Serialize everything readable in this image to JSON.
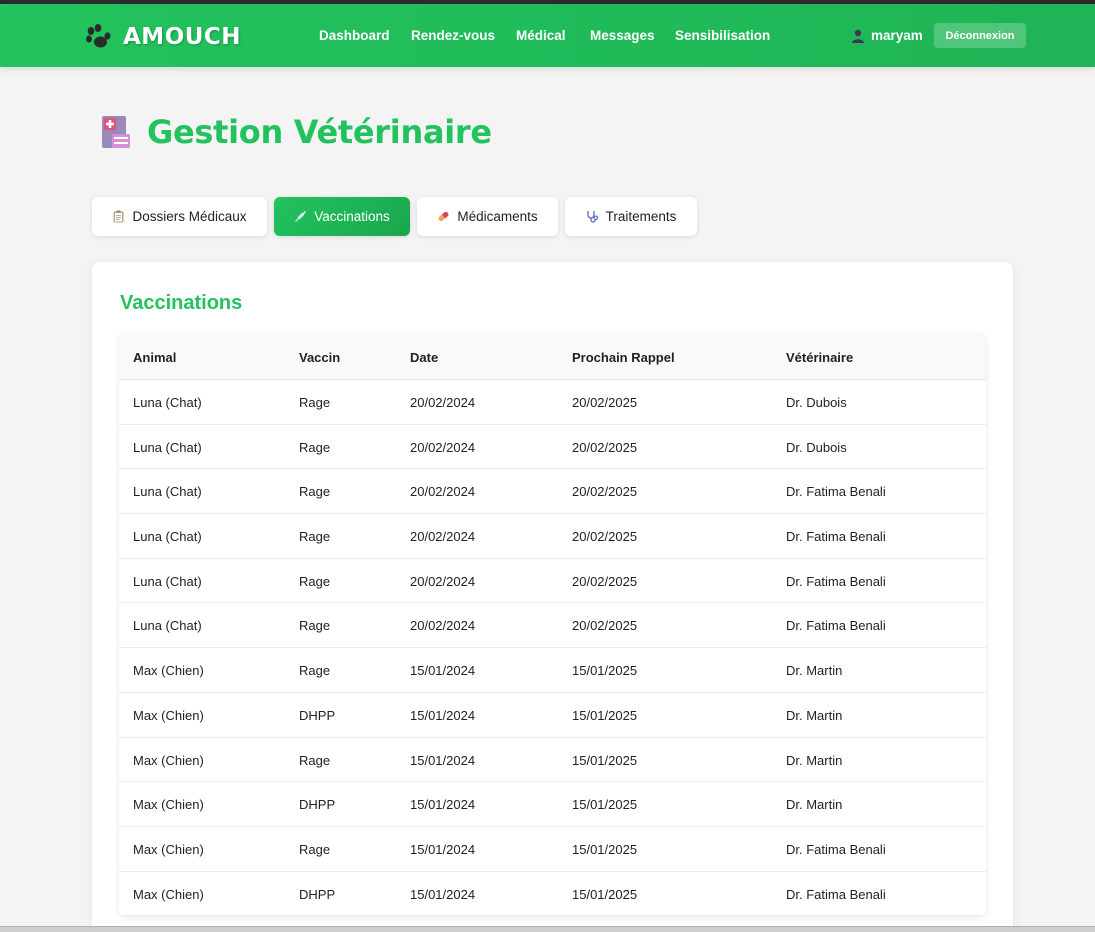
{
  "header": {
    "brand": "AMOUCH",
    "nav": [
      "Dashboard",
      "Rendez-vous",
      "Médical",
      "Messages",
      "Sensibilisation"
    ],
    "user": "maryam",
    "logout_label": "Déconnexion"
  },
  "page": {
    "title": "Gestion Vétérinaire",
    "tabs": [
      {
        "label": "Dossiers Médicaux",
        "icon": "clipboard-icon",
        "active": false
      },
      {
        "label": "Vaccinations",
        "icon": "syringe-icon",
        "active": true
      },
      {
        "label": "Médicaments",
        "icon": "pill-icon",
        "active": false
      },
      {
        "label": "Traitements",
        "icon": "stethoscope-icon",
        "active": false
      }
    ]
  },
  "section": {
    "title": "Vaccinations",
    "columns": [
      "Animal",
      "Vaccin",
      "Date",
      "Prochain Rappel",
      "Vétérinaire"
    ],
    "rows": [
      [
        "Luna (Chat)",
        "Rage",
        "20/02/2024",
        "20/02/2025",
        "Dr. Dubois"
      ],
      [
        "Luna (Chat)",
        "Rage",
        "20/02/2024",
        "20/02/2025",
        "Dr. Dubois"
      ],
      [
        "Luna (Chat)",
        "Rage",
        "20/02/2024",
        "20/02/2025",
        "Dr. Fatima Benali"
      ],
      [
        "Luna (Chat)",
        "Rage",
        "20/02/2024",
        "20/02/2025",
        "Dr. Fatima Benali"
      ],
      [
        "Luna (Chat)",
        "Rage",
        "20/02/2024",
        "20/02/2025",
        "Dr. Fatima Benali"
      ],
      [
        "Luna (Chat)",
        "Rage",
        "20/02/2024",
        "20/02/2025",
        "Dr. Fatima Benali"
      ],
      [
        "Max (Chien)",
        "Rage",
        "15/01/2024",
        "15/01/2025",
        "Dr. Martin"
      ],
      [
        "Max (Chien)",
        "DHPP",
        "15/01/2024",
        "15/01/2025",
        "Dr. Martin"
      ],
      [
        "Max (Chien)",
        "Rage",
        "15/01/2024",
        "15/01/2025",
        "Dr. Martin"
      ],
      [
        "Max (Chien)",
        "DHPP",
        "15/01/2024",
        "15/01/2025",
        "Dr. Martin"
      ],
      [
        "Max (Chien)",
        "Rage",
        "15/01/2024",
        "15/01/2025",
        "Dr. Fatima Benali"
      ],
      [
        "Max (Chien)",
        "DHPP",
        "15/01/2024",
        "15/01/2025",
        "Dr. Fatima Benali"
      ]
    ]
  },
  "colors": {
    "brand_green": "#22c35e",
    "brand_green_dark": "#1aa64e"
  }
}
